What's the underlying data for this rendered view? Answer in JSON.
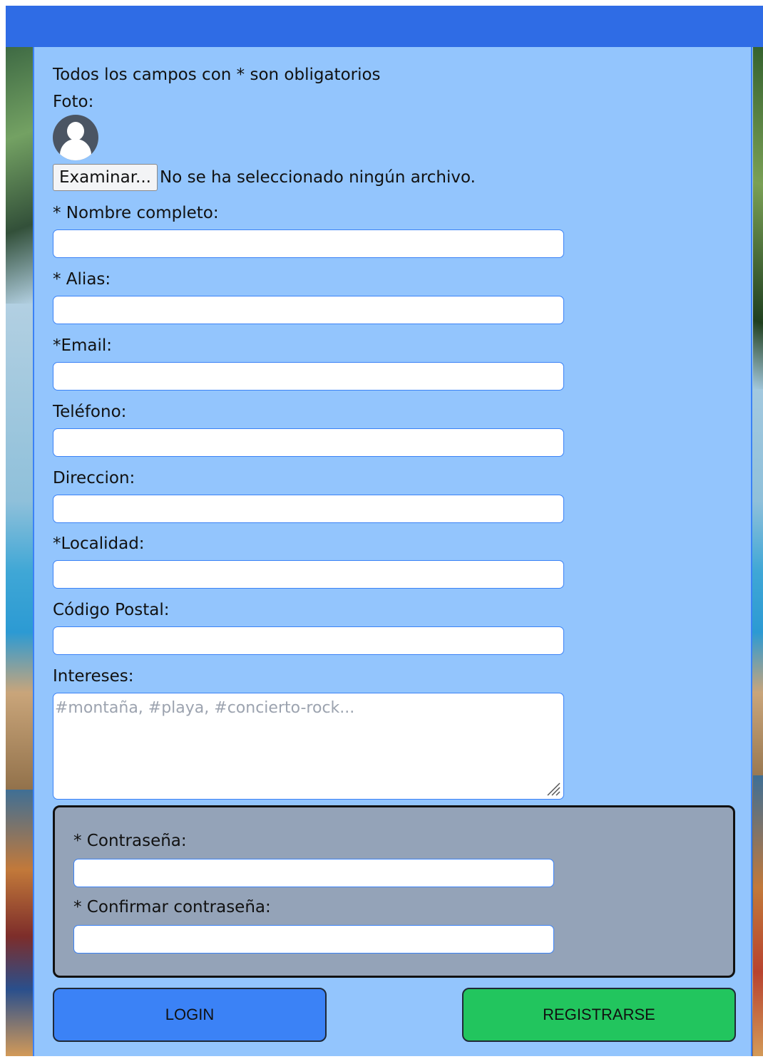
{
  "form": {
    "required_note": "Todos los campos con * son obligatorios",
    "photo_label": "Foto:",
    "file_button": "Examinar...",
    "file_status": "No se ha seleccionado ningún archivo.",
    "fields": {
      "nombre_label": "* Nombre completo:",
      "alias_label": "* Alias:",
      "email_label": "*Email:",
      "telefono_label": "Teléfono:",
      "direccion_label": "Direccion:",
      "localidad_label": "*Localidad:",
      "codigo_postal_label": "Código Postal:",
      "intereses_label": "Intereses:",
      "intereses_placeholder": "#montaña, #playa, #concierto-rock..."
    },
    "password_section": {
      "password_label": "* Contraseña:",
      "confirm_label": "* Confirmar contraseña:"
    },
    "buttons": {
      "login": "LOGIN",
      "register": "REGISTRARSE"
    }
  },
  "colors": {
    "header": "#2f6ce5",
    "panel": "#93c5fd",
    "password_box": "#94a3b8",
    "login_button": "#3b82f6",
    "register_button": "#22c55e"
  },
  "icons": {
    "avatar": "user-avatar-icon",
    "resize": "resize-grip-icon"
  }
}
